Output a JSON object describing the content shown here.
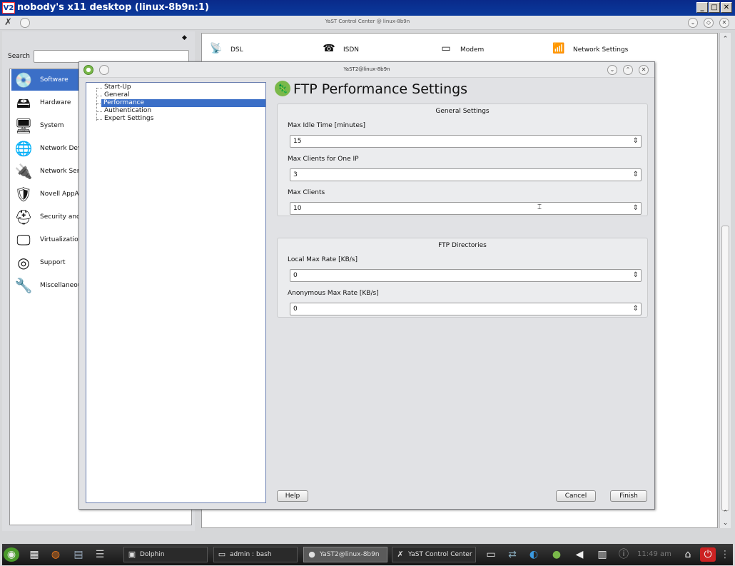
{
  "vnc": {
    "title": "nobody's x11 desktop (linux-8b9n:1)",
    "logo": "V2"
  },
  "control_center": {
    "title": "YaST Control Center @ linux-8b9n",
    "search_label": "Search",
    "search_value": "",
    "categories": [
      {
        "label": "Software",
        "icon": "software-icon"
      },
      {
        "label": "Hardware",
        "icon": "hardware-icon"
      },
      {
        "label": "System",
        "icon": "system-icon"
      },
      {
        "label": "Network Devices",
        "icon": "network-devices-icon"
      },
      {
        "label": "Network Services",
        "icon": "network-services-icon"
      },
      {
        "label": "Novell AppArmor",
        "icon": "apparmor-icon"
      },
      {
        "label": "Security and Users",
        "icon": "security-icon"
      },
      {
        "label": "Virtualization",
        "icon": "virtualization-icon"
      },
      {
        "label": "Support",
        "icon": "support-icon"
      },
      {
        "label": "Miscellaneous",
        "icon": "miscellaneous-icon"
      }
    ],
    "modules": [
      {
        "label": "DSL",
        "icon": "dsl-icon"
      },
      {
        "label": "ISDN",
        "icon": "isdn-icon"
      },
      {
        "label": "Modem",
        "icon": "modem-icon"
      },
      {
        "label": "Network Settings",
        "icon": "network-settings-icon"
      }
    ]
  },
  "dialog": {
    "title": "YaST2@linux-8b9n",
    "heading": "FTP Performance Settings",
    "tree": [
      "Start-Up",
      "General",
      "Performance",
      "Authentication",
      "Expert Settings"
    ],
    "general": {
      "title": "General Settings",
      "max_idle_label": "Max Idle Time [minutes]",
      "max_idle_value": "15",
      "max_clients_ip_label": "Max Clients for One IP",
      "max_clients_ip_value": "3",
      "max_clients_label": "Max Clients",
      "max_clients_value": "10"
    },
    "directories": {
      "title": "FTP Directories",
      "local_rate_label": "Local Max Rate [KB/s]",
      "local_rate_value": "0",
      "anon_rate_label": "Anonymous Max Rate [KB/s]",
      "anon_rate_value": "0"
    },
    "buttons": {
      "help": "Help",
      "cancel": "Cancel",
      "finish": "Finish"
    }
  },
  "taskbar": {
    "tasks": [
      "Dolphin",
      "admin : bash",
      "YaST2@linux-8b9n",
      "YaST Control Center"
    ],
    "clock": "11:49 am"
  }
}
